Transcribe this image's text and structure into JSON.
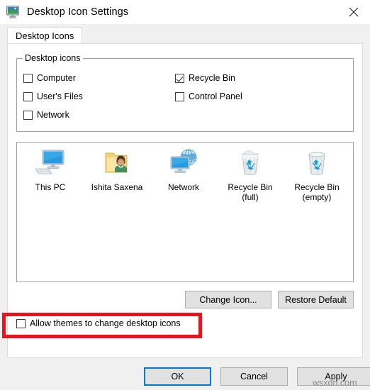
{
  "window": {
    "title": "Desktop Icon Settings",
    "icon": "monitor-desktop-icon",
    "close_label": "✕"
  },
  "tabs": [
    {
      "label": "Desktop Icons",
      "selected": true
    }
  ],
  "desktop_icons_group": {
    "legend": "Desktop icons",
    "checkboxes": [
      {
        "label": "Computer",
        "checked": false
      },
      {
        "label": "Recycle Bin",
        "checked": true
      },
      {
        "label": "User's Files",
        "checked": false
      },
      {
        "label": "Control Panel",
        "checked": false
      },
      {
        "label": "Network",
        "checked": false
      }
    ]
  },
  "icon_preview": {
    "items": [
      {
        "caption": "This PC",
        "icon": "this-pc-icon"
      },
      {
        "caption": "Ishita Saxena",
        "icon": "user-folder-icon"
      },
      {
        "caption": "Network",
        "icon": "network-icon"
      },
      {
        "caption": "Recycle Bin\n(full)",
        "icon": "recycle-bin-full-icon"
      },
      {
        "caption": "Recycle Bin\n(empty)",
        "icon": "recycle-bin-empty-icon"
      }
    ]
  },
  "icon_actions": {
    "change_icon": "Change Icon...",
    "restore_default": "Restore Default"
  },
  "allow_themes": {
    "label": "Allow themes to change desktop icons",
    "checked": false
  },
  "footer": {
    "ok": "OK",
    "cancel": "Cancel",
    "apply": "Apply"
  },
  "watermark": "wsxdn.com",
  "colors": {
    "accent": "#0078d7",
    "annotation": "#e8131c",
    "button_face": "#e1e1e1",
    "window_face": "#f0f0f0"
  }
}
